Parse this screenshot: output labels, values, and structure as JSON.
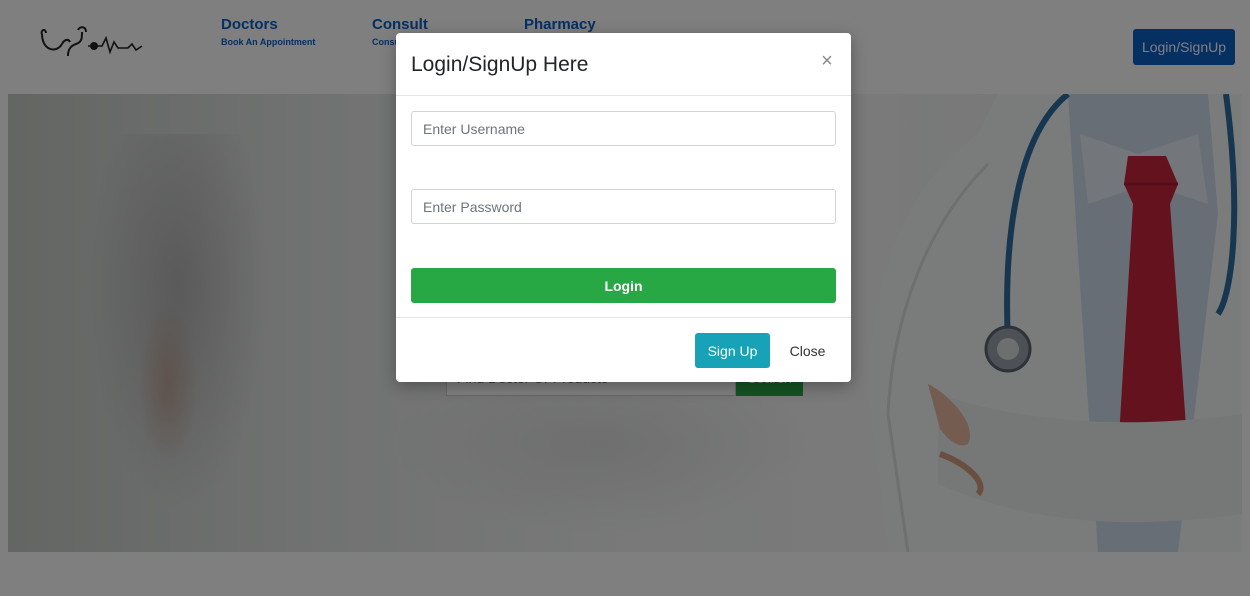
{
  "navbar": {
    "logo_icon": "stethoscope-heartbeat-icon",
    "items": [
      {
        "title": "Doctors",
        "subtitle": "Book An Appointment"
      },
      {
        "title": "Consult",
        "subtitle": "Consu"
      },
      {
        "title": "Pharmacy",
        "subtitle": ""
      }
    ],
    "login_signup_label": "Login/SignUp"
  },
  "hero": {
    "search_placeholder": "Find Doctor Or Products",
    "search_button_label": "Search"
  },
  "modal": {
    "title": "Login/SignUp Here",
    "close_icon": "close-icon",
    "close_symbol": "×",
    "username_placeholder": "Enter Username",
    "password_placeholder": "Enter Password",
    "login_label": "Login",
    "signup_label": "Sign Up",
    "close_label": "Close"
  },
  "colors": {
    "brand_blue": "#0d5ec4",
    "success_green": "#28a745",
    "info_teal": "#17a2b8",
    "tie_red": "#c8243d",
    "stethoscope_blue": "#2f6fa3"
  }
}
